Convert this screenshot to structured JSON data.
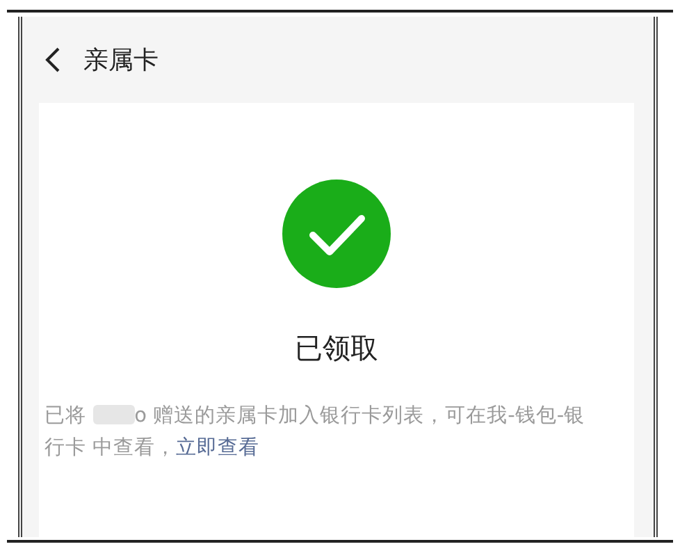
{
  "header": {
    "title": "亲属卡"
  },
  "result": {
    "kind": "success",
    "title": "已领取",
    "message_before": "已将",
    "message_after": "o 赠送的亲属卡加入银行卡列表，可在我-钱包-银行卡 中查看，",
    "link": "立即查看"
  }
}
